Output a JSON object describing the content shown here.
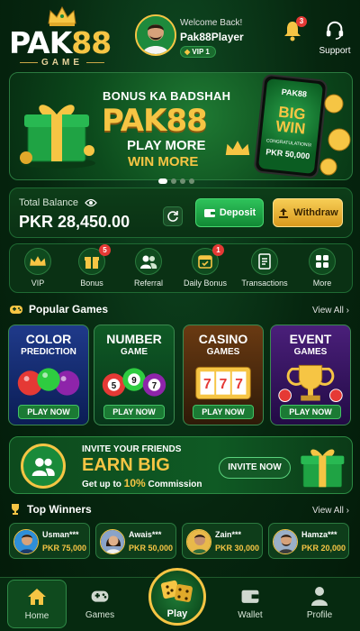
{
  "header": {
    "logo_text_main": "PAK",
    "logo_text_num": "88",
    "logo_sub": "GAME",
    "welcome": "Welcome Back!",
    "username": "Pak88Player",
    "vip": "VIP 1",
    "notification_count": "3",
    "support_label": "Support"
  },
  "banner": {
    "line1": "BONUS KA BADSHAH",
    "line2": "PAK88",
    "line3": "PLAY MORE",
    "line4": "WIN MORE",
    "phone_logo": "PAK88",
    "phone_big": "BIG",
    "phone_win": "WIN",
    "phone_congrats": "CONGRATULATIONS!",
    "phone_amount": "PKR 50,000"
  },
  "balance": {
    "label": "Total Balance",
    "value": "PKR 28,450.00",
    "deposit": "Deposit",
    "withdraw": "Withdraw"
  },
  "quick_menu": [
    {
      "label": "VIP",
      "icon": "crown-icon",
      "badge": ""
    },
    {
      "label": "Bonus",
      "icon": "gift-icon",
      "badge": "5"
    },
    {
      "label": "Referral",
      "icon": "users-icon",
      "badge": ""
    },
    {
      "label": "Daily Bonus",
      "icon": "calendar-icon",
      "badge": "1"
    },
    {
      "label": "Transactions",
      "icon": "receipt-icon",
      "badge": ""
    },
    {
      "label": "More",
      "icon": "grid-icon",
      "badge": ""
    }
  ],
  "popular": {
    "title": "Popular Games",
    "view_all": "View All",
    "games": [
      {
        "title": "COLOR",
        "sub": "PREDICTION",
        "button": "PLAY NOW"
      },
      {
        "title": "NUMBER",
        "sub": "GAME",
        "button": "PLAY NOW"
      },
      {
        "title": "CASINO",
        "sub": "GAMES",
        "button": "PLAY NOW"
      },
      {
        "title": "EVENT",
        "sub": "GAMES",
        "button": "PLAY NOW"
      }
    ]
  },
  "invite": {
    "line1": "INVITE YOUR FRIENDS",
    "line2": "EARN BIG",
    "line3_pre": "Get up to ",
    "line3_pct": "10%",
    "line3_post": " Commission",
    "button": "INVITE NOW"
  },
  "winners": {
    "title": "Top Winners",
    "view_all": "View All",
    "items": [
      {
        "name": "Usman***",
        "amount": "PKR 75,000"
      },
      {
        "name": "Awais***",
        "amount": "PKR 50,000"
      },
      {
        "name": "Zain***",
        "amount": "PKR 30,000"
      },
      {
        "name": "Hamza***",
        "amount": "PKR 20,000"
      }
    ]
  },
  "nav": {
    "home": "Home",
    "games": "Games",
    "play": "Play",
    "wallet": "Wallet",
    "profile": "Profile"
  },
  "colors": {
    "gold": "#f6c544",
    "green_bg": "#06260f",
    "accent_green": "#2ec25a"
  }
}
